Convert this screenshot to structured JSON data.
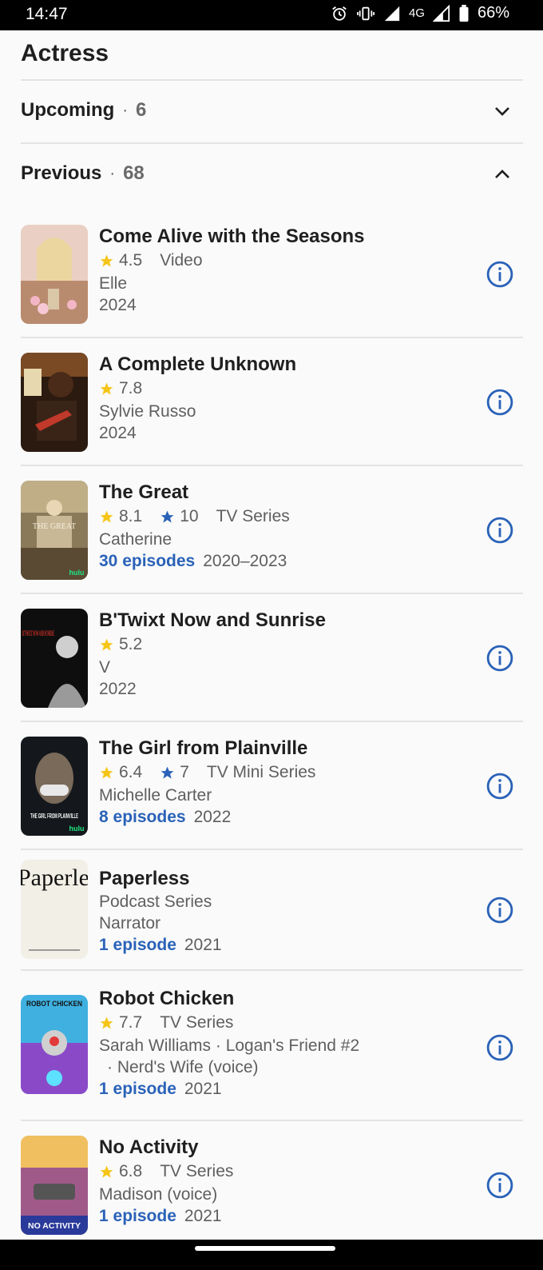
{
  "status_bar": {
    "time": "14:47",
    "network": "4G",
    "battery": "66%"
  },
  "section": {
    "title": "Actress"
  },
  "groups": [
    {
      "label": "Upcoming",
      "separator": "·",
      "count": "6",
      "expanded": false
    },
    {
      "label": "Previous",
      "separator": "·",
      "count": "68",
      "expanded": true
    }
  ],
  "items": [
    {
      "title": "Come Alive with the Seasons",
      "rating": "4.5",
      "type": "Video",
      "role": "Elle",
      "episodes": "",
      "years": "2024"
    },
    {
      "title": "A Complete Unknown",
      "rating": "7.8",
      "role": "Sylvie Russo",
      "years": "2024"
    },
    {
      "title": "The Great",
      "rating": "8.1",
      "user_rating": "10",
      "type": "TV Series",
      "role": "Catherine",
      "episodes": "30 episodes",
      "years": "2020–2023"
    },
    {
      "title": "B'Twixt Now and Sunrise",
      "rating": "5.2",
      "role": "V",
      "years": "2022"
    },
    {
      "title": "The Girl from Plainville",
      "rating": "6.4",
      "user_rating": "7",
      "type": "TV Mini Series",
      "role": "Michelle Carter",
      "episodes": "8 episodes",
      "years": "2022"
    },
    {
      "title": "Paperless",
      "type": "Podcast Series",
      "role": "Narrator",
      "episodes": "1 episode",
      "years": "2021"
    },
    {
      "title": "Robot Chicken",
      "rating": "7.7",
      "type": "TV Series",
      "role": "Sarah Williams  ·  Logan's Friend #2",
      "role_cont": "·  Nerd's Wife (voice)",
      "episodes": "1 episode",
      "years": "2021"
    },
    {
      "title": "No Activity",
      "rating": "6.8",
      "type": "TV Series",
      "role": "Madison (voice)",
      "episodes": "1 episode",
      "years": "2021"
    }
  ],
  "poster_text": {
    "paperless": "Paperless",
    "robot_chicken": "ROBOT CHICKEN",
    "no_activity": "NO ACTIVITY",
    "the_great": "THE GREAT",
    "btwixt": "B'TWIXT NOW AND SUNRISE",
    "plainville": "THE GIRL FROM PLAINVILLE",
    "hulu": "hulu"
  },
  "colors": {
    "accent_blue": "#2a62b8",
    "imdb_star": "#f5c518",
    "user_star": "#2a62b8"
  }
}
